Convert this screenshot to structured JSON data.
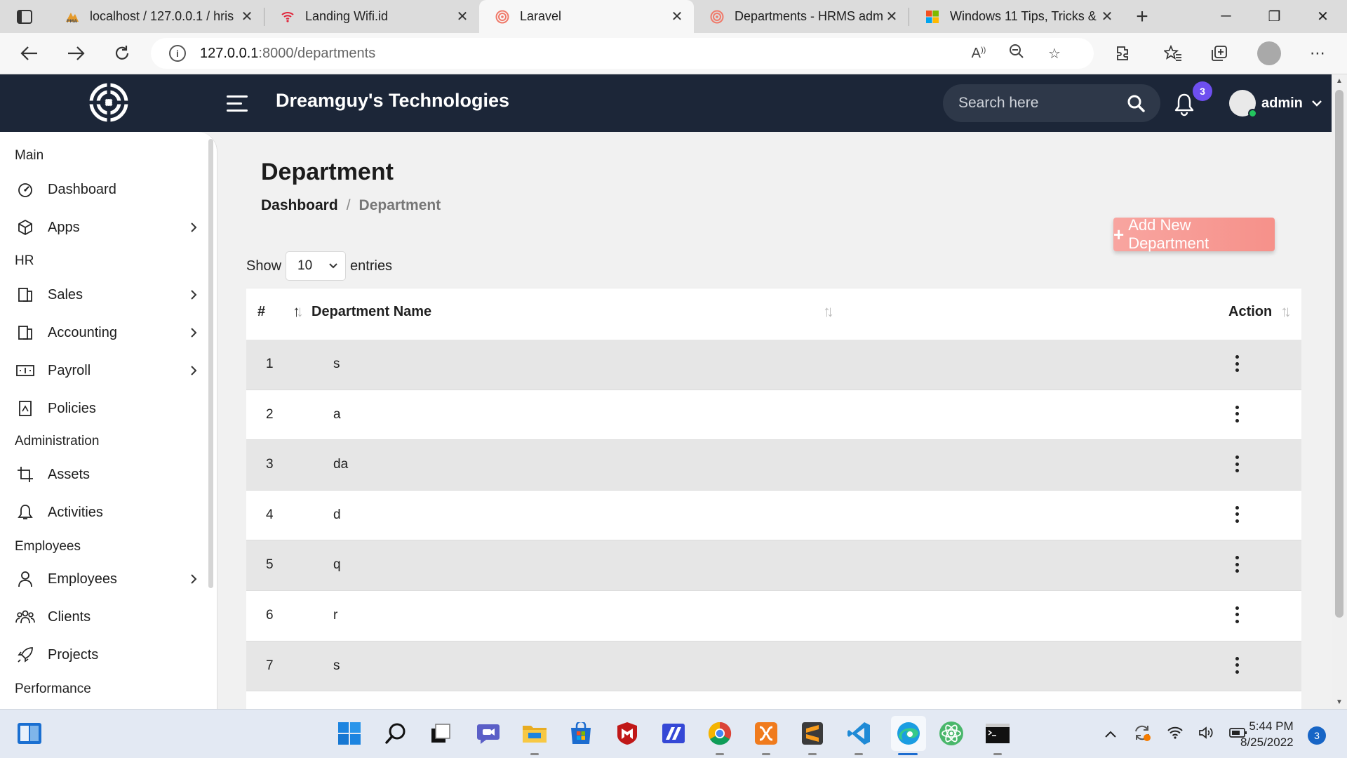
{
  "browser": {
    "tabs": [
      {
        "title": "localhost / 127.0.0.1 / hris",
        "favicon": "phpmyadmin-icon",
        "active": false
      },
      {
        "title": "Landing Wifi.id",
        "favicon": "wifi-icon",
        "active": false
      },
      {
        "title": "Laravel",
        "favicon": "target-icon",
        "active": true
      },
      {
        "title": "Departments - HRMS adm",
        "favicon": "target-icon",
        "active": false
      },
      {
        "title": "Windows 11 Tips, Tricks &",
        "favicon": "windows-icon",
        "active": false
      }
    ],
    "url_host": "127.0.0.1",
    "url_path": ":8000/departments"
  },
  "header": {
    "brand": "Dreamguy's Technologies",
    "search_placeholder": "Search here",
    "notification_count": "3",
    "user_name": "admin"
  },
  "sidebar": {
    "sections": {
      "main": "Main",
      "hr": "HR",
      "administration": "Administration",
      "employees": "Employees",
      "performance": "Performance"
    },
    "items": {
      "dashboard": "Dashboard",
      "apps": "Apps",
      "sales": "Sales",
      "accounting": "Accounting",
      "payroll": "Payroll",
      "policies": "Policies",
      "assets": "Assets",
      "activities": "Activities",
      "employees": "Employees",
      "clients": "Clients",
      "projects": "Projects"
    }
  },
  "page": {
    "title": "Department",
    "breadcrumb_home": "Dashboard",
    "breadcrumb_sep": "/",
    "breadcrumb_current": "Department",
    "add_button": "Add New Department",
    "show_label": "Show",
    "entries_value": "10",
    "entries_label": "entries"
  },
  "table": {
    "headers": {
      "num": "#",
      "name": "Department Name",
      "action": "Action"
    },
    "rows": [
      {
        "num": "1",
        "name": "s"
      },
      {
        "num": "2",
        "name": "a"
      },
      {
        "num": "3",
        "name": "da"
      },
      {
        "num": "4",
        "name": "d"
      },
      {
        "num": "5",
        "name": "q"
      },
      {
        "num": "6",
        "name": "r"
      },
      {
        "num": "7",
        "name": "s"
      }
    ]
  },
  "taskbar": {
    "time": "5:44 PM",
    "date": "8/25/2022",
    "notification_count": "3"
  },
  "colors": {
    "header_bg": "#1c2638",
    "add_button": "#f6918a",
    "badge": "#6e4ff0",
    "row_stripe": "#e6e6e6"
  }
}
